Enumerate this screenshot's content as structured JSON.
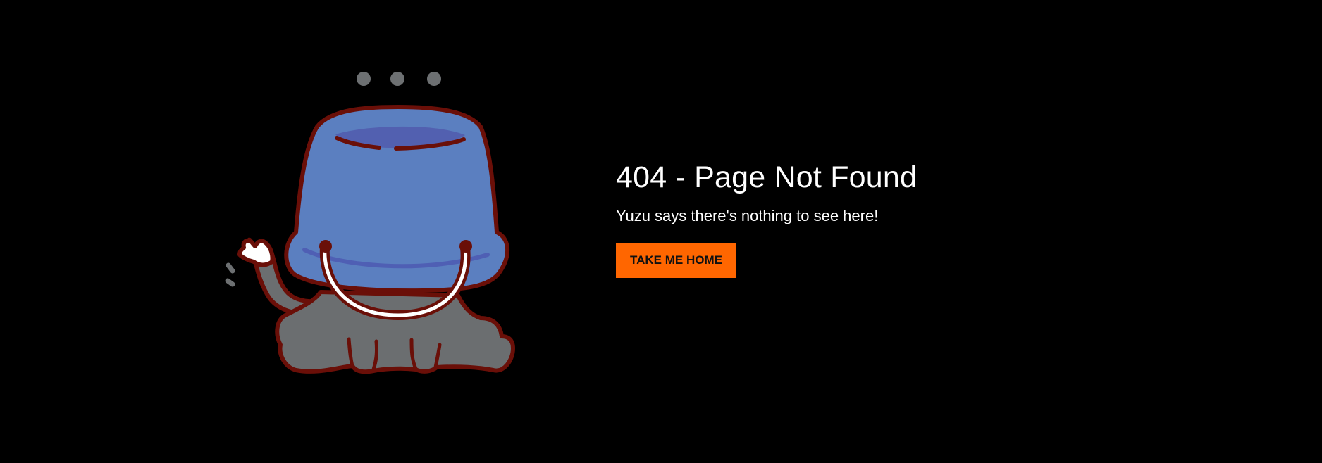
{
  "error": {
    "title": "404 - Page Not Found",
    "message": "Yuzu says there's nothing to see here!",
    "button_label": "TAKE ME HOME"
  },
  "illustration": {
    "icon": "yuzu-cat-bucket-icon"
  },
  "colors": {
    "background": "#000000",
    "text": "#ffffff",
    "accent": "#ff6600",
    "bucket": "#5b7fc0",
    "outline": "#6a0f08",
    "cat": "#6b6e70"
  }
}
